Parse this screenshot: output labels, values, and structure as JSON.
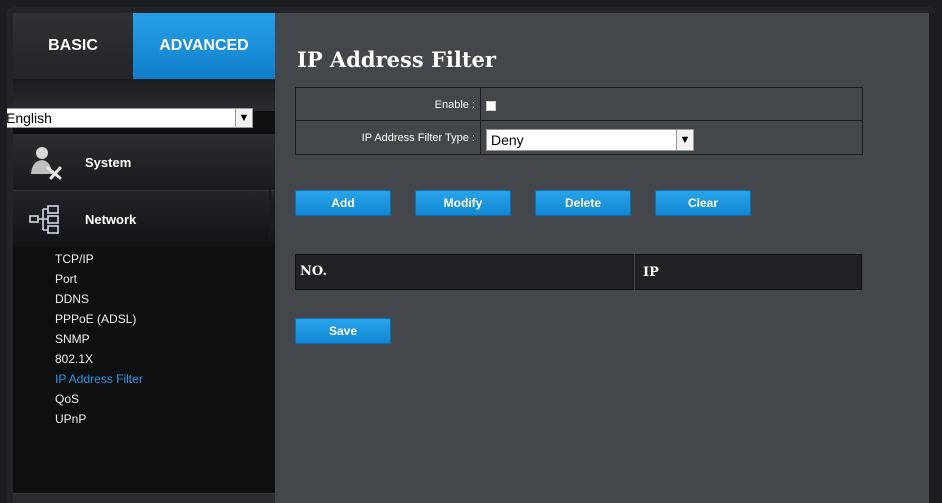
{
  "tabs": {
    "basic": "BASIC",
    "advanced": "ADVANCED"
  },
  "language": {
    "selected": "English"
  },
  "menu": {
    "system": "System",
    "network": "Network",
    "network_items": [
      {
        "label": "TCP/IP"
      },
      {
        "label": "Port"
      },
      {
        "label": "DDNS"
      },
      {
        "label": "PPPoE (ADSL)"
      },
      {
        "label": "SNMP"
      },
      {
        "label": "802.1X"
      },
      {
        "label": "IP Address Filter",
        "active": true
      },
      {
        "label": "QoS"
      },
      {
        "label": "UPnP"
      }
    ]
  },
  "page": {
    "title": "IP Address Filter",
    "enable_label": "Enable :",
    "enable_checked": false,
    "filter_type_label": "IP Address Filter Type :",
    "filter_type_value": "Deny"
  },
  "buttons": {
    "add": "Add",
    "modify": "Modify",
    "delete": "Delete",
    "clear": "Clear",
    "save": "Save"
  },
  "list": {
    "col_no": "NO.",
    "col_ip": "IP",
    "rows": []
  },
  "colors": {
    "accent": "#1d9ae6",
    "panel": "#43464b",
    "sidebar": "#0e0f11"
  }
}
